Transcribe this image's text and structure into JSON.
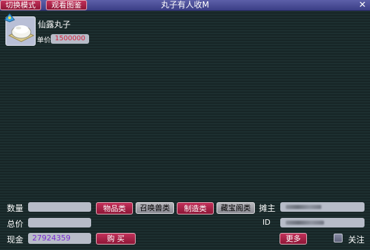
{
  "window": {
    "title": "丸子有人收M",
    "close_glyph": "✕"
  },
  "top_buttons": {
    "switch_mode": "切换模式",
    "view_catalog": "观看图鉴"
  },
  "item": {
    "name": "仙露丸子",
    "unit_price_label": "单价",
    "unit_price": "1500000",
    "icon": "bowl-dumpling-icon"
  },
  "form": {
    "quantity_label": "数量",
    "quantity_value": "",
    "total_label": "总价",
    "total_value": "",
    "cash_label": "现金",
    "cash_value": "27924359"
  },
  "categories": [
    {
      "label": "物品类",
      "active": true
    },
    {
      "label": "召唤兽类",
      "active": false
    },
    {
      "label": "制造类",
      "active": true
    },
    {
      "label": "藏宝阁类",
      "active": false
    }
  ],
  "buy_button": "购 买",
  "seller": {
    "owner_label": "摊主",
    "id_label": "ID"
  },
  "more_button": "更多",
  "follow_label": "关注",
  "colors": {
    "red_button": "#a8234a",
    "title_bar": "#4a4d98",
    "price_text": "#d3233e",
    "cash_text": "#7a2bd1"
  }
}
